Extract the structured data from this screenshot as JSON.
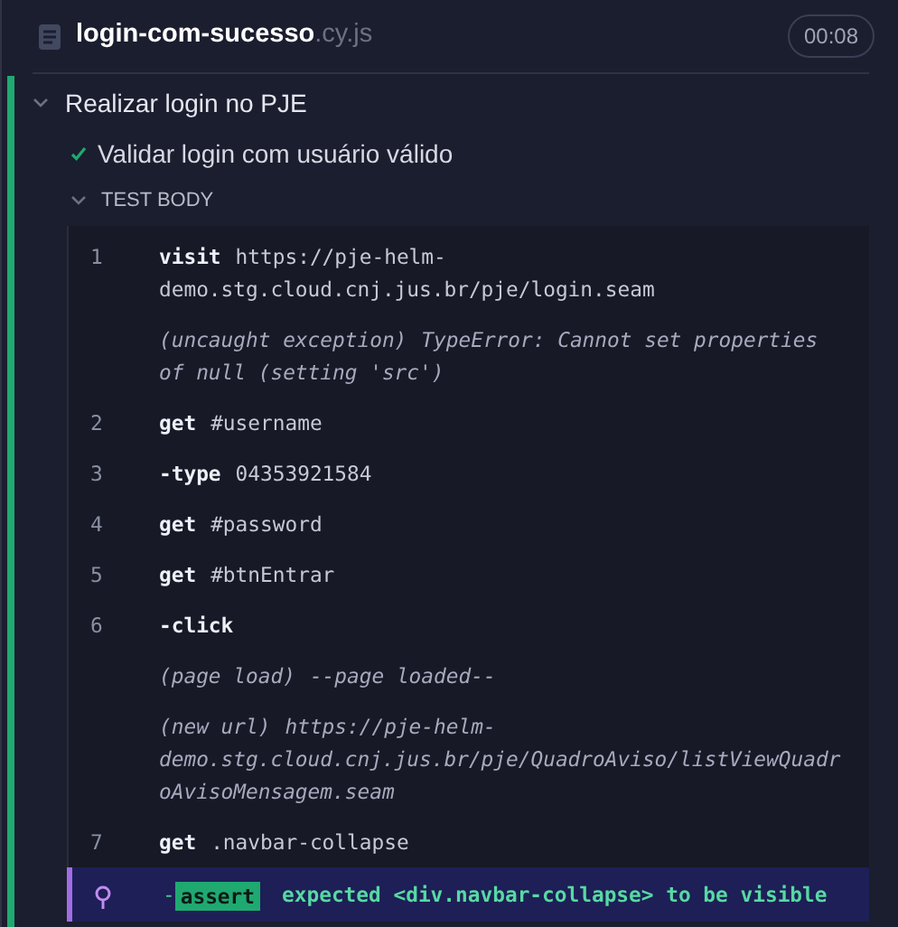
{
  "header": {
    "file_name": "login-com-sucesso",
    "file_ext": ".cy.js",
    "duration": "00:08"
  },
  "suite": {
    "title": "Realizar login no PJE",
    "expanded": true,
    "test": {
      "title": "Validar login com usuário válido",
      "passed": true,
      "section": {
        "title": "TEST BODY",
        "expanded": true,
        "commands": [
          {
            "kind": "command",
            "number": "1",
            "name": "visit",
            "message": "https://pje-helm-demo.stg.cloud.cnj.jus.br/pje/login.seam"
          },
          {
            "kind": "event",
            "name": "(uncaught exception)",
            "message": "TypeError: Cannot set properties of null (setting 'src')"
          },
          {
            "kind": "command",
            "number": "2",
            "name": "get",
            "message": "#username"
          },
          {
            "kind": "command",
            "number": "3",
            "name": "-type",
            "message": "04353921584"
          },
          {
            "kind": "command",
            "number": "4",
            "name": "get",
            "message": "#password"
          },
          {
            "kind": "command",
            "number": "5",
            "name": "get",
            "message": "#btnEntrar"
          },
          {
            "kind": "command",
            "number": "6",
            "name": "-click"
          },
          {
            "kind": "event",
            "name": "(page load)",
            "message": "--page loaded--"
          },
          {
            "kind": "event",
            "name": "(new url)",
            "message": "https://pje-helm-demo.stg.cloud.cnj.jus.br/pje/QuadroAviso/listViewQuadroAvisoMensagem.seam"
          },
          {
            "kind": "command",
            "number": "7",
            "name": "get",
            "message": ".navbar-collapse"
          },
          {
            "kind": "assert",
            "prefix": "-",
            "name": "assert",
            "message": "expected <div.navbar-collapse> to be visible"
          }
        ]
      }
    }
  }
}
